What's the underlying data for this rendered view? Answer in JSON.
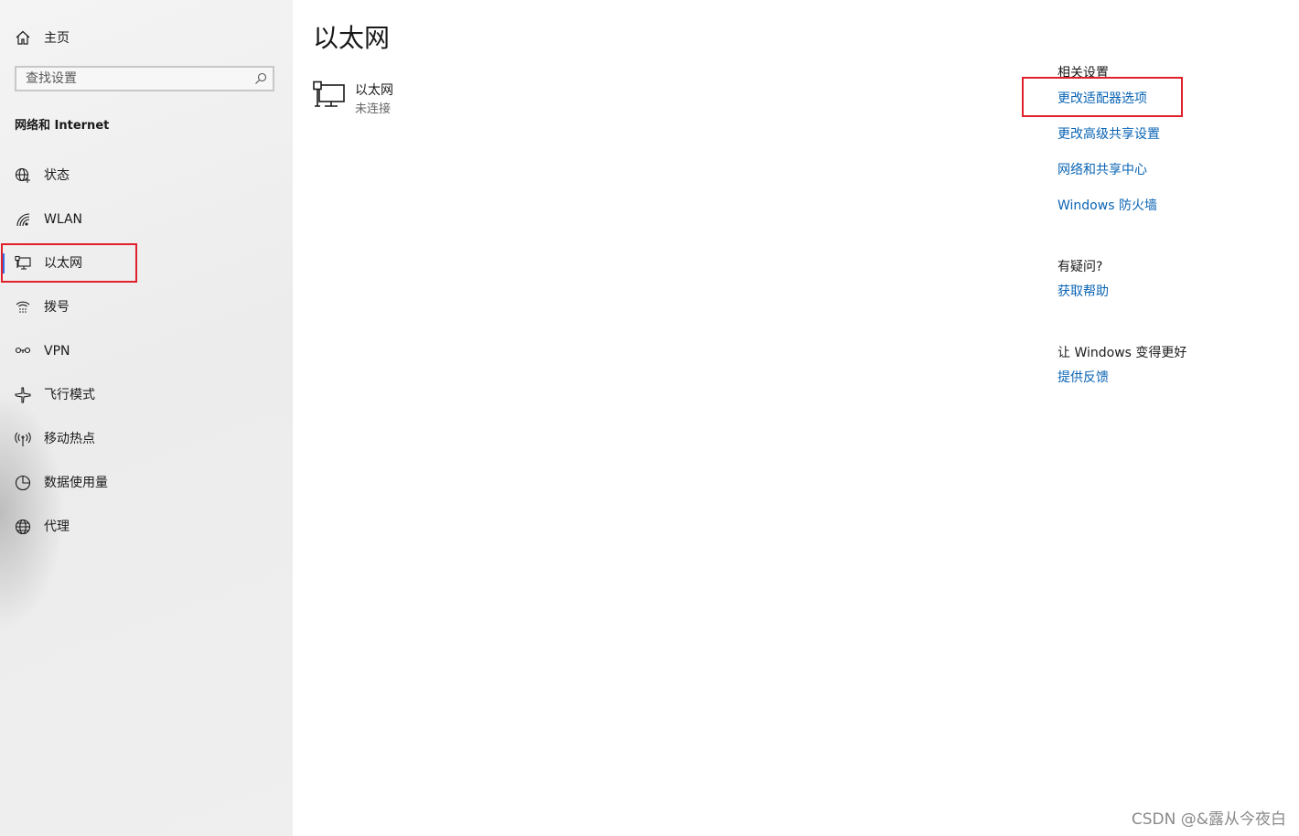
{
  "sidebar": {
    "home_label": "主页",
    "search_placeholder": "查找设置",
    "section_title": "网络和 Internet",
    "items": [
      {
        "label": "状态",
        "icon": "status-globe-icon"
      },
      {
        "label": "WLAN",
        "icon": "wifi-icon"
      },
      {
        "label": "以太网",
        "icon": "ethernet-icon",
        "selected": true
      },
      {
        "label": "拨号",
        "icon": "dialup-icon"
      },
      {
        "label": "VPN",
        "icon": "vpn-icon"
      },
      {
        "label": "飞行模式",
        "icon": "airplane-icon"
      },
      {
        "label": "移动热点",
        "icon": "hotspot-icon"
      },
      {
        "label": "数据使用量",
        "icon": "data-usage-icon"
      },
      {
        "label": "代理",
        "icon": "proxy-globe-icon"
      }
    ]
  },
  "main": {
    "title": "以太网",
    "adapter": {
      "name": "以太网",
      "status": "未连接"
    }
  },
  "related": {
    "heading": "相关设置",
    "links": [
      "更改适配器选项",
      "更改高级共享设置",
      "网络和共享中心",
      "Windows 防火墙"
    ],
    "question_heading": "有疑问?",
    "help_link": "获取帮助",
    "improve_heading": "让 Windows 变得更好",
    "feedback_link": "提供反馈"
  },
  "watermark": "CSDN @&露从今夜白",
  "colors": {
    "accent": "#0a64b4",
    "highlight_box": "#e0202a",
    "selection_bar": "#3a6ee8"
  }
}
